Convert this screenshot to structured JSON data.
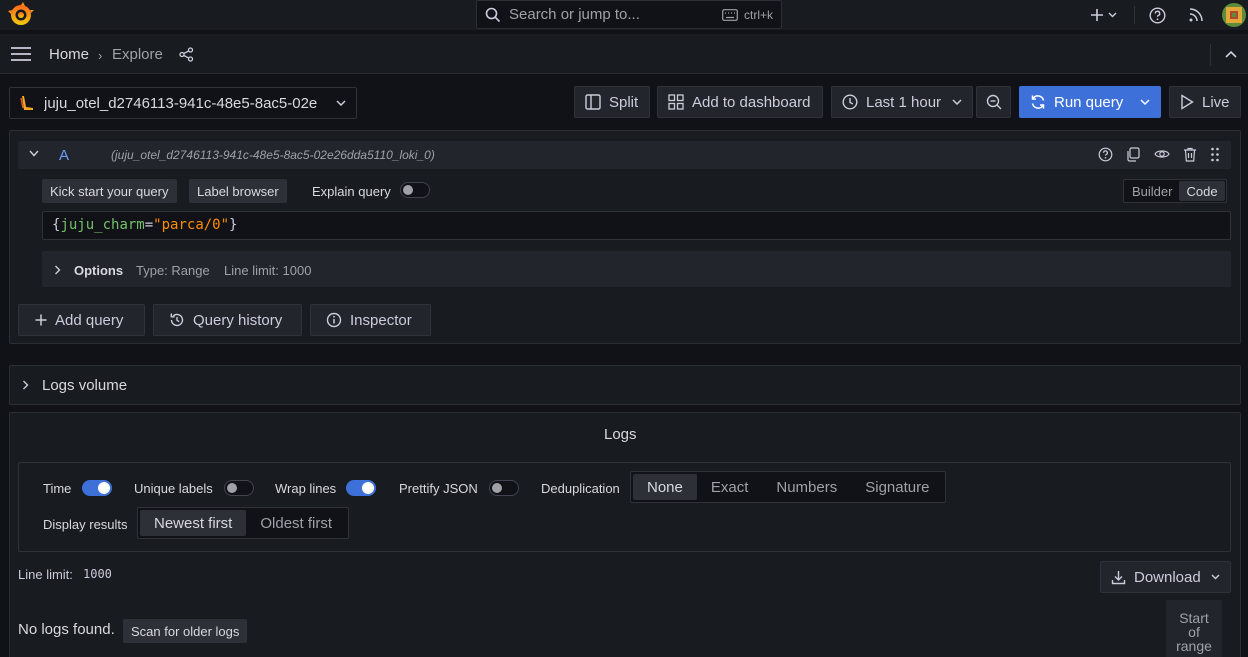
{
  "topbar": {
    "search_placeholder": "Search or jump to...",
    "search_shortcut": "ctrl+k"
  },
  "nav": {
    "breadcrumbs": [
      "Home",
      "Explore"
    ],
    "separator": "›"
  },
  "toolbar": {
    "datasource": "juju_otel_d2746113-941c-48e5-8ac5-02e",
    "split": "Split",
    "add_to_dashboard": "Add to dashboard",
    "time_range": "Last 1 hour",
    "run_query": "Run query",
    "live": "Live"
  },
  "query": {
    "ref_id": "A",
    "datasource_full": "(juju_otel_d2746113-941c-48e5-8ac5-02e26dda5110_loki_0)",
    "kick_start": "Kick start your query",
    "label_browser": "Label browser",
    "explain_query": "Explain query",
    "explain_on": false,
    "mode_builder": "Builder",
    "mode_code": "Code",
    "expr": {
      "open": "{",
      "label": "juju_charm",
      "eq": "=",
      "value": "\"parca/0\"",
      "close": "}"
    },
    "options": {
      "label": "Options",
      "type": "Type: Range",
      "line_limit": "Line limit: 1000"
    }
  },
  "query_actions": {
    "add_query": "Add query",
    "query_history": "Query history",
    "inspector": "Inspector"
  },
  "logs_volume": {
    "title": "Logs volume"
  },
  "logs": {
    "title": "Logs",
    "time": "Time",
    "time_on": true,
    "unique_labels": "Unique labels",
    "unique_labels_on": false,
    "wrap_lines": "Wrap lines",
    "wrap_lines_on": true,
    "prettify_json": "Prettify JSON",
    "prettify_json_on": false,
    "dedup_label": "Deduplication",
    "dedup_options": [
      "None",
      "Exact",
      "Numbers",
      "Signature"
    ],
    "dedup_selected": "None",
    "display_results": "Display results",
    "order_options": [
      "Newest first",
      "Oldest first"
    ],
    "order_selected": "Newest first",
    "line_limit_label": "Line limit:",
    "line_limit_value": "1000",
    "download": "Download",
    "no_logs": "No logs found.",
    "scan_older": "Scan for older logs",
    "start_of_range": [
      "Start",
      "of",
      "range"
    ]
  },
  "colors": {
    "primary": "#3d71d9",
    "label_key": "#73bf69",
    "string_value": "#ff8c00",
    "ref_id": "#6e9fff"
  }
}
